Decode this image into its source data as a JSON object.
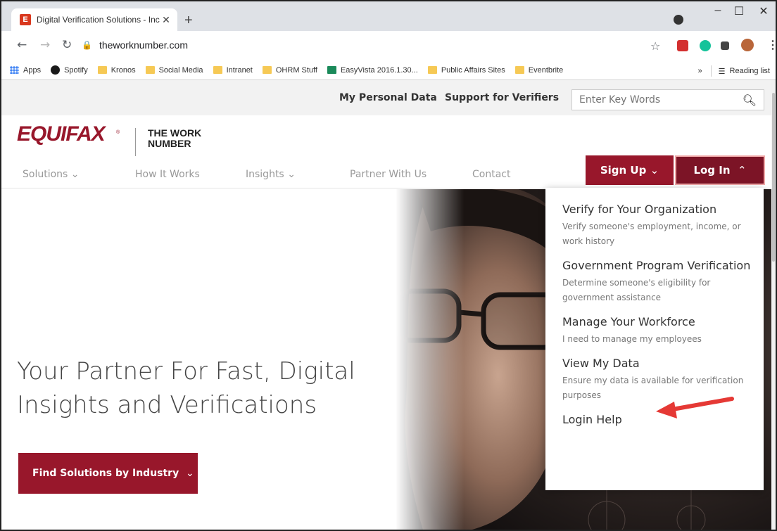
{
  "browser": {
    "tab_title": "Digital Verification Solutions - Inc",
    "tab_favicon_letter": "E",
    "new_tab_symbol": "+",
    "url": "theworknumber.com",
    "window_controls": {
      "minimize": "–",
      "maximize": "☐",
      "close": "✕"
    }
  },
  "bookmarks": {
    "items": [
      "Apps",
      "Spotify",
      "Kronos",
      "Social Media",
      "Intranet",
      "OHRM Stuff",
      "EasyVista 2016.1.30...",
      "Public Affairs Sites",
      "Eventbrite"
    ],
    "overflow": "»",
    "reading_list": "Reading list"
  },
  "utility": {
    "personal_data": "My Personal Data",
    "support_verifiers": "Support for Verifiers",
    "search_placeholder": "Enter Key Words"
  },
  "logo": {
    "brand": "EQUIFAX",
    "reg": "®",
    "sub_line1": "THE WORK",
    "sub_line2": "NUMBER"
  },
  "nav": {
    "solutions": "Solutions",
    "how_it_works": "How It Works",
    "insights": "Insights",
    "partner": "Partner With Us",
    "contact": "Contact",
    "sign_up": "Sign Up",
    "log_in": "Log In"
  },
  "hero": {
    "title_line1": "Your Partner For Fast, Digital",
    "title_line2": "Insights and Verifications",
    "cta": "Find Solutions by Industry"
  },
  "login_menu": {
    "items": [
      {
        "title": "Verify for Your Organization",
        "desc": "Verify someone's employment, income, or work history"
      },
      {
        "title": "Government Program Verification",
        "desc": "Determine someone's eligibility for government assistance"
      },
      {
        "title": "Manage Your Workforce",
        "desc": "I need to manage my employees"
      },
      {
        "title": "View My Data",
        "desc": "Ensure my data is available for verification purposes"
      },
      {
        "title": "Login Help",
        "desc": ""
      }
    ]
  },
  "colors": {
    "brand": "#98172b",
    "brand_dark": "#7c1426",
    "annotation_arrow": "#e53935"
  }
}
